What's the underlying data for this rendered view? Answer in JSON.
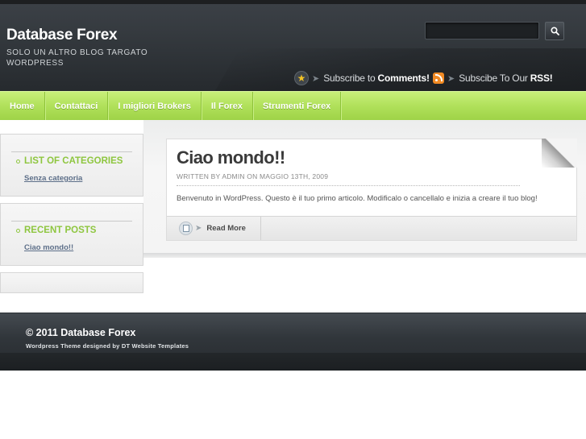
{
  "header": {
    "site_title": "Database Forex",
    "tagline": "SOLO UN ALTRO BLOG TARGATO WORDPRESS",
    "search": {
      "placeholder": "",
      "value": ""
    },
    "subscribe_comments": {
      "prefix": "Subscribe to",
      "strong": "Comments!"
    },
    "subscribe_rss": {
      "prefix": "Subscibe To Our",
      "strong": "RSS!"
    }
  },
  "nav": {
    "items": [
      {
        "label": "Home"
      },
      {
        "label": "Contattaci"
      },
      {
        "label": "I migliori Brokers"
      },
      {
        "label": "Il Forex"
      },
      {
        "label": "Strumenti Forex"
      }
    ]
  },
  "sidebar": {
    "categories": {
      "title": "LIST OF CATEGORIES",
      "links": [
        "Senza categoria"
      ]
    },
    "recent_posts": {
      "title": "RECENT POSTS",
      "links": [
        "Ciao mondo!!"
      ]
    }
  },
  "post": {
    "title": "Ciao mondo!!",
    "meta": "WRITTEN BY ADMIN ON MAGGIO 13TH, 2009",
    "body": "Benvenuto in WordPress. Questo è il tuo primo articolo. Modificalo o cancellalo e inizia a creare il tuo blog!",
    "read_more": "Read More"
  },
  "footer": {
    "copyright": "© 2011 Database Forex",
    "credit": "Wordpress Theme designed by DT Website Templates"
  },
  "colors": {
    "accent_green": "#8ec63f",
    "nav_green": "#b0e05a",
    "header_dark": "#353a3f",
    "link_blue": "#5d6f89"
  }
}
